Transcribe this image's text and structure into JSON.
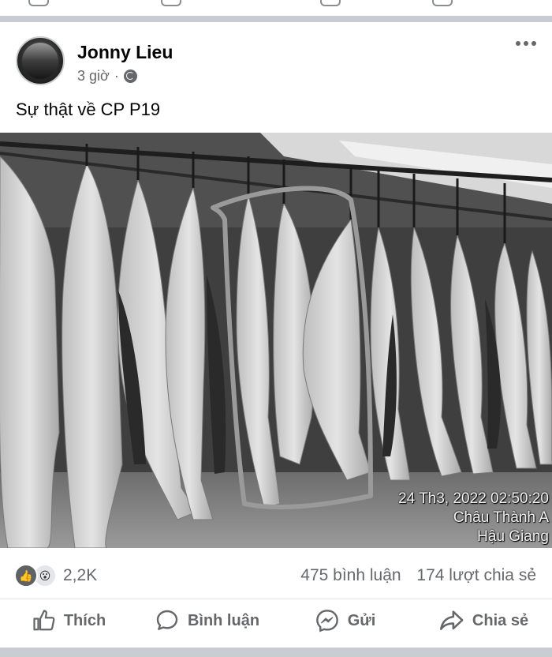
{
  "post": {
    "author": "Jonny Lieu",
    "time": "3 giờ",
    "privacy_icon": "globe-icon",
    "text": "Sự thật về CP P19"
  },
  "photo": {
    "timestamp": "24 Th3, 2022 02:50:20",
    "location_line1": "Châu Thành A",
    "location_line2": "Hậu Giang"
  },
  "stats": {
    "reaction_count": "2,2K",
    "comments": "475 bình luận",
    "shares": "174 lượt chia sẻ"
  },
  "actions": {
    "like": "Thích",
    "comment": "Bình luận",
    "send": "Gửi",
    "share": "Chia sẻ"
  },
  "colors": {
    "muted_text": "#65676b",
    "separator": "#c9ccd1"
  }
}
